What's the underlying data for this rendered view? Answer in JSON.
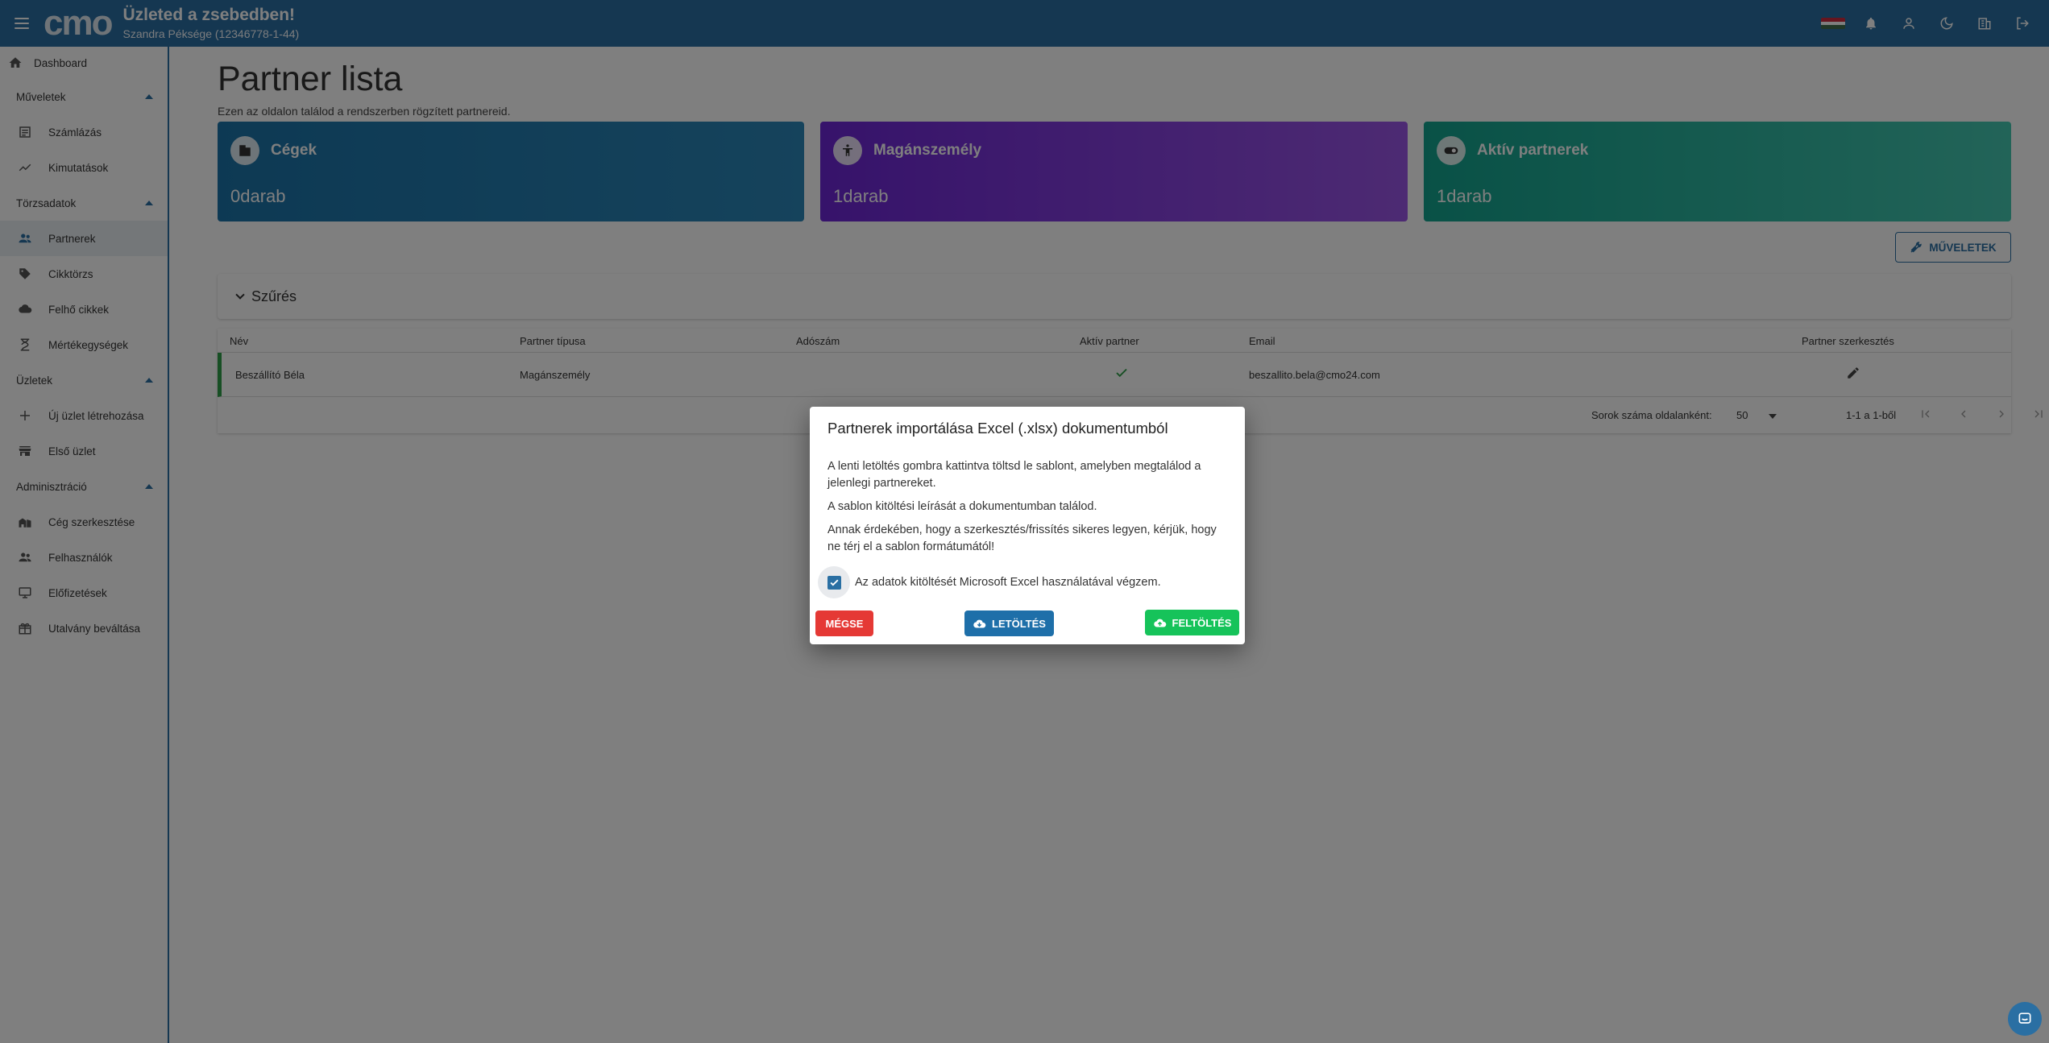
{
  "header": {
    "title": "Üzleted a zsebedben!",
    "subtitle": "Szandra Péksége (12346778-1-44)",
    "logo": "cmo",
    "icons": [
      "hungarian-flag-icon",
      "bell-icon",
      "user-icon",
      "moon-icon",
      "building-icon",
      "logout-icon"
    ],
    "color": "#2a6fa3"
  },
  "sidebar": {
    "dashboard": "Dashboard",
    "sections": [
      {
        "label": "Műveletek",
        "items": [
          "Számlázás",
          "Kimutatások"
        ]
      },
      {
        "label": "Törzsadatok",
        "items": [
          "Partnerek",
          "Cikktörzs",
          "Felhő cikkek",
          "Mértékegységek"
        ]
      },
      {
        "label": "Üzletek",
        "items": [
          "Új üzlet létrehozása",
          "Első üzlet"
        ]
      },
      {
        "label": "Adminisztráció",
        "items": [
          "Cég szerkesztése",
          "Felhasználók",
          "Előfizetések",
          "Utalvány beváltása"
        ]
      }
    ],
    "active": "Partnerek"
  },
  "main": {
    "title": "Partner lista",
    "subtitle": "Ezen az oldalon találod a rendszerben rögzített partnereid.",
    "cards": [
      {
        "label": "Cégek",
        "value": "0darab",
        "icon": "building-icon",
        "color": "#1b73a8"
      },
      {
        "label": "Magánszemély",
        "value": "1darab",
        "icon": "person-icon",
        "color": "#7b32dc"
      },
      {
        "label": "Aktív partnerek",
        "value": "1darab",
        "icon": "toggle-icon",
        "color": "#1fae98"
      }
    ],
    "operations_button": "MŰVELETEK",
    "filter_label": "Szűrés",
    "table": {
      "columns": [
        "Név",
        "Partner típusa",
        "Adószám",
        "Aktív partner",
        "Email",
        "Partner szerkesztés"
      ],
      "rows": [
        {
          "name": "Beszállító Béla",
          "type": "Magánszemély",
          "tax": "",
          "active": true,
          "email": "beszallito.bela@cmo24.com"
        }
      ],
      "rows_per_page_label": "Sorok száma oldalanként:",
      "rows_per_page": "50",
      "range": "1-1 a 1-ből"
    }
  },
  "dialog": {
    "title": "Partnerek importálása Excel (.xlsx) dokumentumból",
    "p1": "A lenti letöltés gombra kattintva töltsd le sablont, amelyben megtalálod a jelenlegi partnereket.",
    "p2": "A sablon kitöltési leírását a dokumentumban találod.",
    "p3": "Annak érdekében, hogy a szerkesztés/frissítés sikeres legyen, kérjük, hogy ne térj el a sablon formátumától!",
    "checkbox_label": "Az adatok kitöltését Microsoft Excel használatával végzem.",
    "checkbox_checked": true,
    "cancel": "MÉGSE",
    "download": "LETÖLTÉS",
    "upload": "FELTÖLTÉS"
  }
}
